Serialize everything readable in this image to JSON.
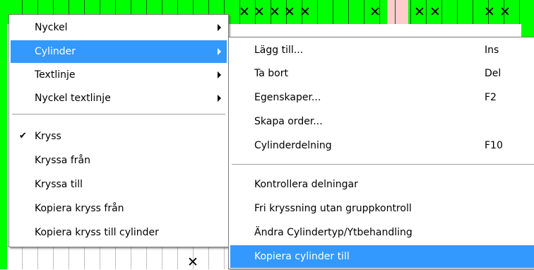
{
  "colors": {
    "grid_green": "#00ff00",
    "grid_pink": "#ffcccc",
    "highlight": "#3399ff"
  },
  "grid": {
    "top_row_marks": [
      "✕",
      "✕",
      "✕",
      "✕",
      "✕",
      "✕",
      "✕",
      "✕",
      "✕"
    ],
    "bottom_marks": [
      "✕"
    ]
  },
  "context_menu": {
    "items": [
      {
        "label": "Nyckel",
        "submenu": true
      },
      {
        "label": "Cylinder",
        "submenu": true,
        "highlighted": true
      },
      {
        "label": "Textlinje",
        "submenu": true
      },
      {
        "label": "Nyckel textlinje",
        "submenu": true
      },
      {
        "label": "Kryss",
        "checked": true
      },
      {
        "label": "Kryssa från"
      },
      {
        "label": "Kryssa till"
      },
      {
        "label": "Kopiera kryss från"
      },
      {
        "label": "Kopiera kryss till cylinder"
      }
    ],
    "check_glyph": "✔"
  },
  "cylinder_submenu": {
    "items": [
      {
        "label": "Lägg till...",
        "shortcut": "Ins"
      },
      {
        "label": "Ta bort",
        "shortcut": "Del"
      },
      {
        "label": "Egenskaper...",
        "shortcut": "F2"
      },
      {
        "label": "Skapa order...",
        "shortcut": ""
      },
      {
        "label": "Cylinderdelning",
        "shortcut": "F10"
      },
      {
        "label": "Kontrollera delningar",
        "shortcut": ""
      },
      {
        "label": "Fri kryssning utan gruppkontroll",
        "shortcut": ""
      },
      {
        "label": "Ändra Cylindertyp/Ytbehandling",
        "shortcut": ""
      },
      {
        "label": "Kopiera cylinder till",
        "shortcut": "",
        "highlighted": true
      }
    ]
  }
}
